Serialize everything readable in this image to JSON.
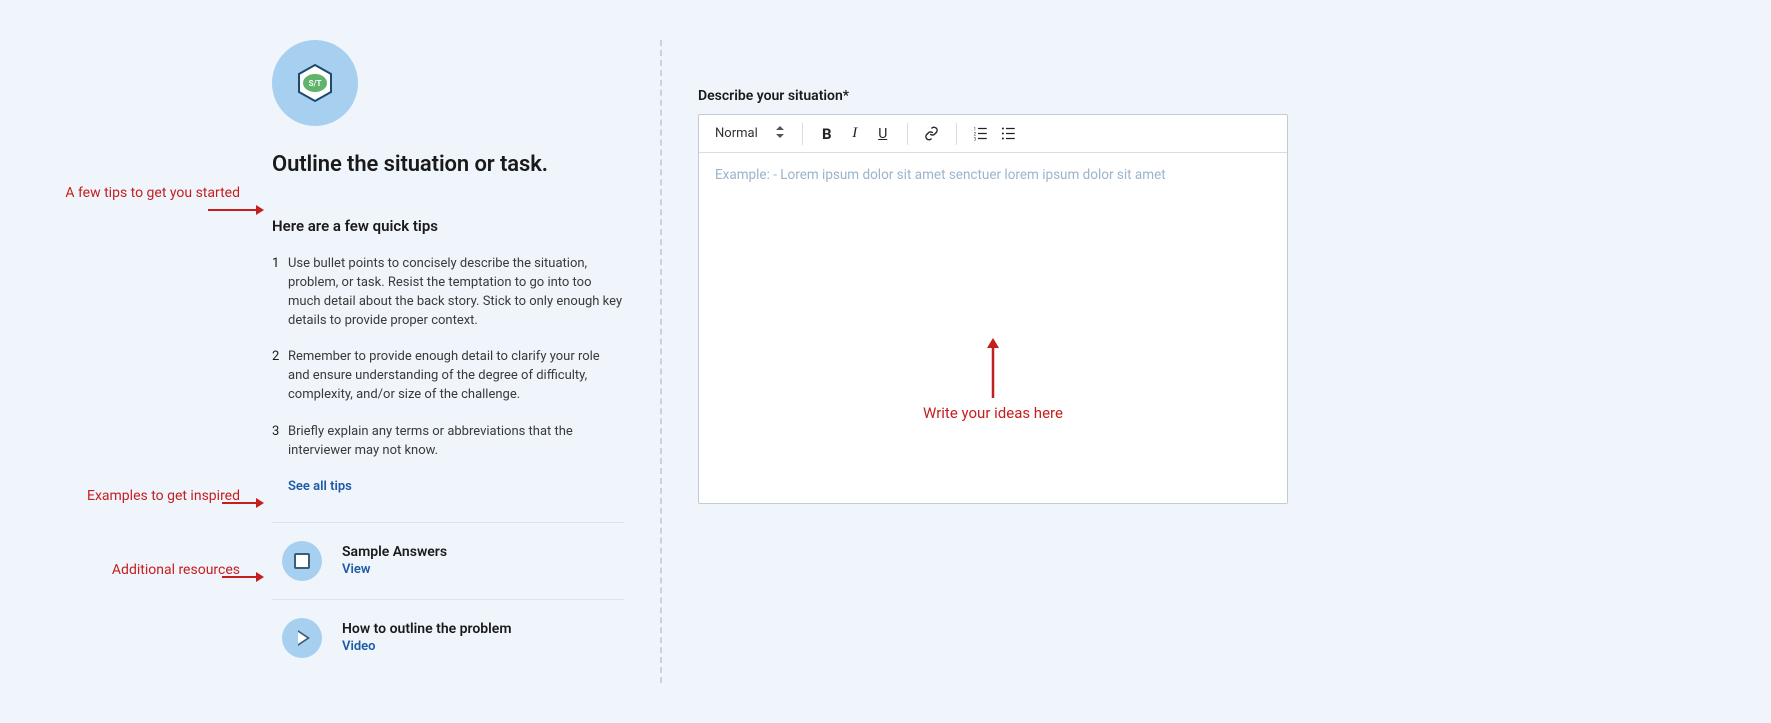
{
  "annotations": {
    "tips": "A few tips to get you started",
    "examples": "Examples to get inspired",
    "resources": "Additional resources",
    "write_here": "Write your ideas here"
  },
  "badge": {
    "label": "S/T"
  },
  "left": {
    "title": "Outline the situation or task.",
    "tips_header": "Here are a few quick tips",
    "tips": [
      "Use bullet points to concisely describe the situation, problem, or task. Resist the temptation to go into too much detail about the back story. Stick to only enough key details to provide proper context.",
      "Remember to provide enough detail to clarify your role and ensure understanding of the degree of difficulty, complexity, and/or size of the challenge.",
      "Briefly explain any terms or abbreviations that the interviewer may not know."
    ],
    "see_all": "See all tips",
    "resources": [
      {
        "title": "Sample Answers",
        "action": "View"
      },
      {
        "title": "How to outline the problem",
        "action": "Video"
      }
    ]
  },
  "right": {
    "field_label": "Describe your situation*",
    "format_selected": "Normal",
    "placeholder": "Example: - Lorem ipsum dolor sit amet senctuer lorem ipsum dolor sit amet"
  }
}
